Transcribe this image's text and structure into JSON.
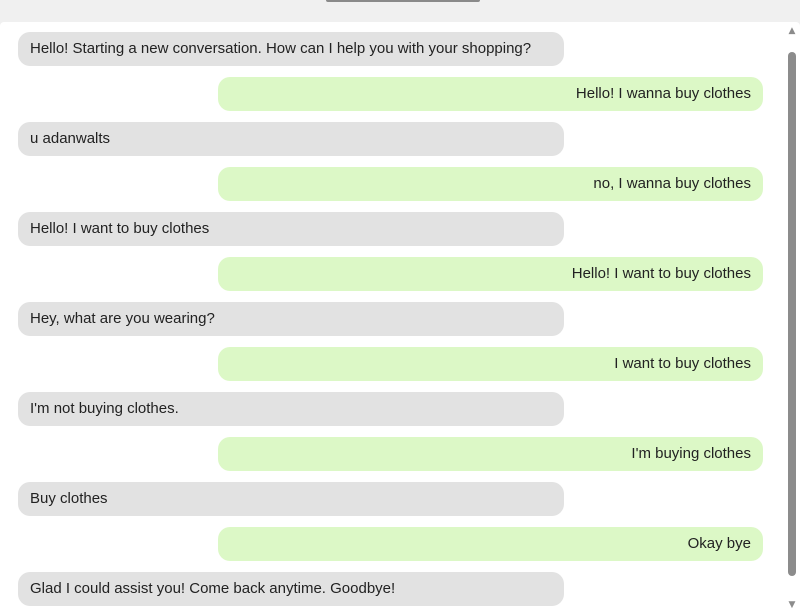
{
  "chat": {
    "messages": [
      {
        "sender": "bot",
        "text": "Hello! Starting a new conversation. How can I help you with your shopping?"
      },
      {
        "sender": "user",
        "text": "Hello! I wanna buy clothes"
      },
      {
        "sender": "bot",
        "text": "u adanwalts"
      },
      {
        "sender": "user",
        "text": "no, I wanna buy clothes"
      },
      {
        "sender": "bot",
        "text": "Hello! I want to buy clothes"
      },
      {
        "sender": "user",
        "text": "Hello! I want to buy clothes"
      },
      {
        "sender": "bot",
        "text": "Hey, what are you wearing?"
      },
      {
        "sender": "user",
        "text": "I want to buy clothes"
      },
      {
        "sender": "bot",
        "text": "I'm not buying clothes."
      },
      {
        "sender": "user",
        "text": "I'm buying clothes"
      },
      {
        "sender": "bot",
        "text": "Buy clothes"
      },
      {
        "sender": "user",
        "text": "Okay bye"
      },
      {
        "sender": "bot",
        "text": "Glad I could assist you! Come back anytime. Goodbye!"
      }
    ],
    "colors": {
      "bot_bubble": "#e2e2e2",
      "user_bubble": "#dcf8c6"
    }
  },
  "scrollbar": {
    "up_icon": "scroll-up-arrow-icon",
    "down_icon": "scroll-down-arrow-icon"
  }
}
